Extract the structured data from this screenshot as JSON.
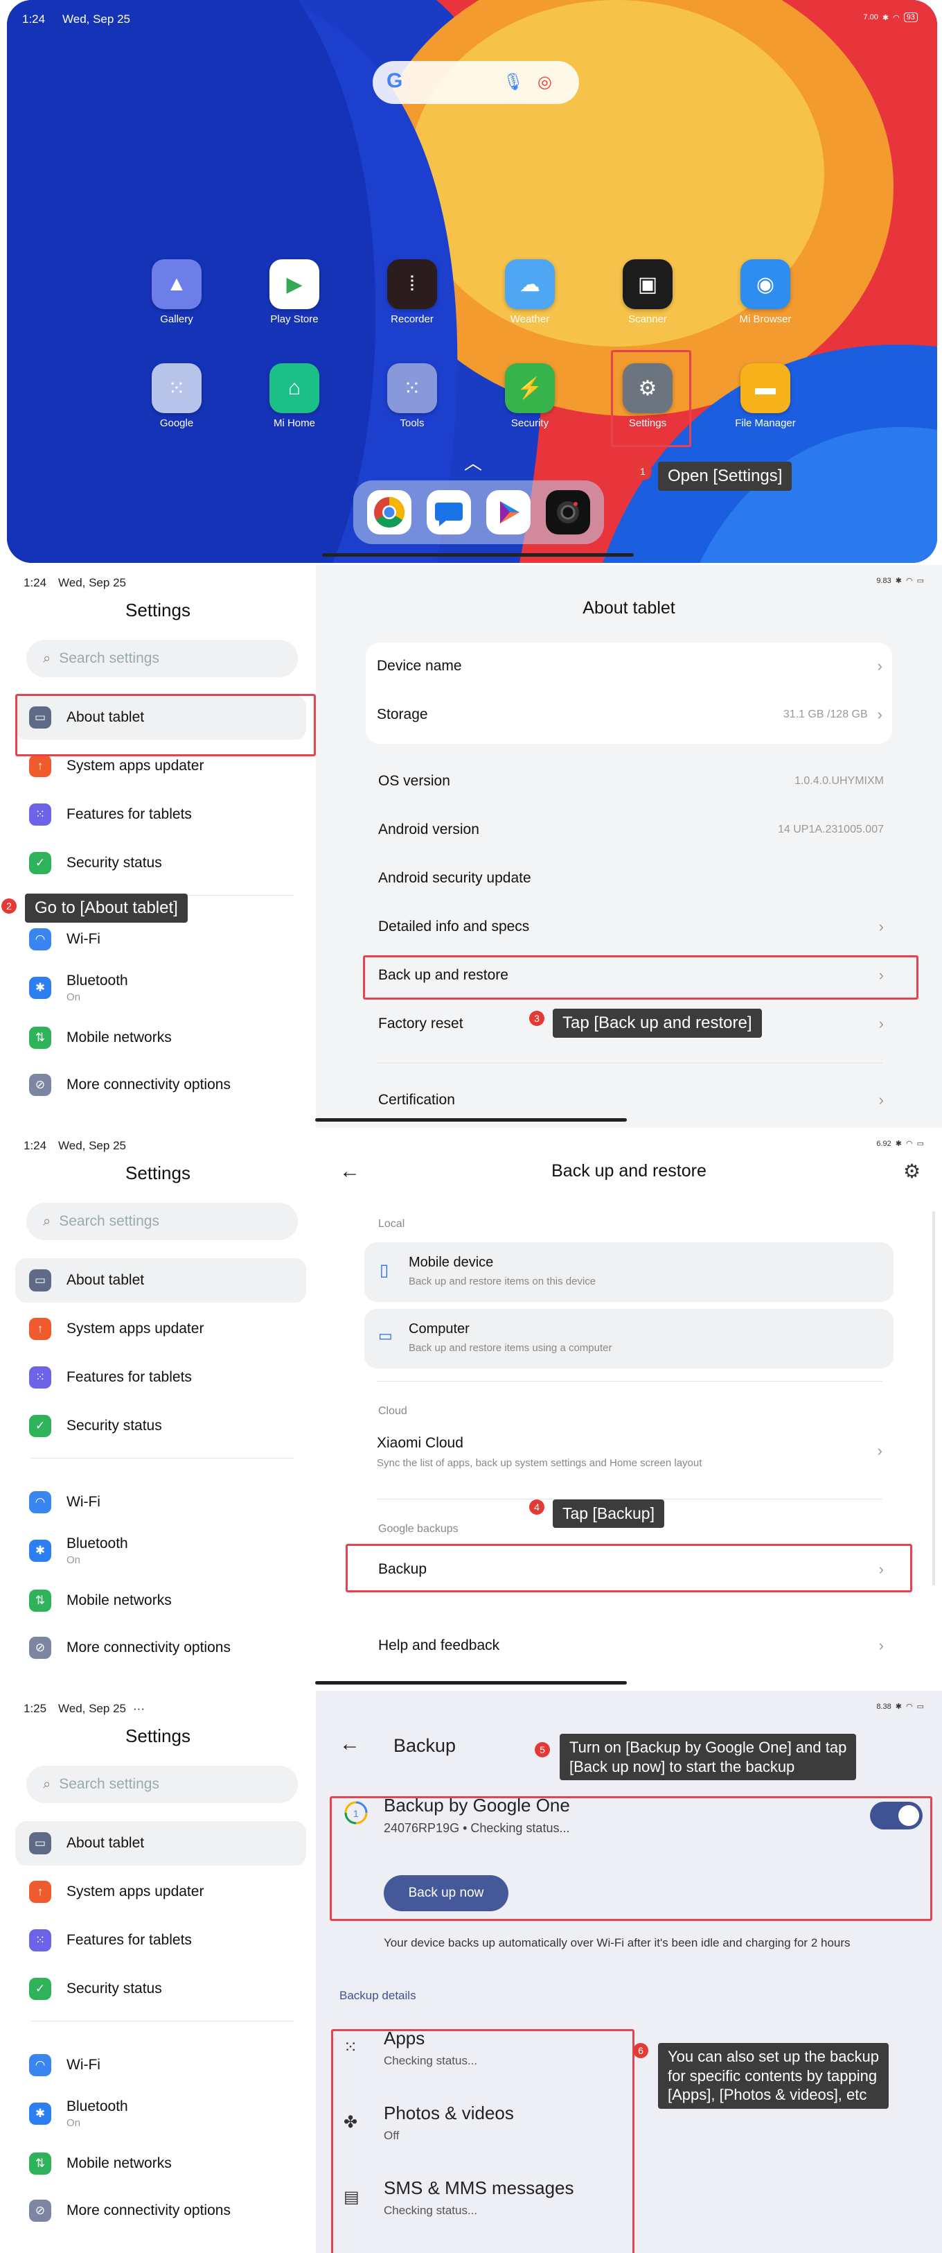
{
  "home": {
    "status_time": "1:24",
    "status_date": "Wed, Sep 25",
    "status_speed": "7.00",
    "status_battery": "93",
    "apps_row1": [
      {
        "label": "Gallery",
        "icon": "gallery-icon",
        "color": "#6d7ee9"
      },
      {
        "label": "Play Store",
        "icon": "play-store-icon",
        "color": "#ffffff"
      },
      {
        "label": "Recorder",
        "icon": "recorder-icon",
        "color": "#2b1d1d"
      },
      {
        "label": "Weather",
        "icon": "weather-icon",
        "color": "#4fa6f2"
      },
      {
        "label": "Scanner",
        "icon": "scanner-icon",
        "color": "#1c1c1c"
      },
      {
        "label": "Mi Browser",
        "icon": "browser-icon",
        "color": "#2f8df0"
      }
    ],
    "apps_row2": [
      {
        "label": "Google",
        "icon": "google-folder-icon",
        "color": "#b7c3e8"
      },
      {
        "label": "Mi Home",
        "icon": "mi-home-icon",
        "color": "#1cbf87"
      },
      {
        "label": "Tools",
        "icon": "tools-folder-icon",
        "color": "#8799da"
      },
      {
        "label": "Security",
        "icon": "security-icon",
        "color": "#36b34a"
      },
      {
        "label": "Settings",
        "icon": "settings-icon",
        "color": "#6c7480"
      },
      {
        "label": "File Manager",
        "icon": "file-manager-icon",
        "color": "#f7b21b"
      }
    ],
    "dock": [
      "chrome-icon",
      "messages-icon",
      "play-games-icon",
      "camera-icon"
    ],
    "tip_number": "1",
    "tip_text": "Open [Settings]"
  },
  "settings_sidebar": {
    "title": "Settings",
    "search_placeholder": "Search settings",
    "items": [
      {
        "label": "About tablet",
        "sub": ""
      },
      {
        "label": "System apps updater",
        "sub": ""
      },
      {
        "label": "Features for tablets",
        "sub": ""
      },
      {
        "label": "Security status",
        "sub": ""
      },
      {
        "label": "Wi-Fi",
        "sub": ""
      },
      {
        "label": "Bluetooth",
        "sub": "On"
      },
      {
        "label": "Mobile networks",
        "sub": ""
      },
      {
        "label": "More connectivity options",
        "sub": ""
      }
    ]
  },
  "panel2": {
    "status_time": "1:24",
    "status_date": "Wed, Sep 25",
    "status_speed": "9.83",
    "title": "About tablet",
    "device_name": "Device name",
    "storage": "Storage",
    "storage_value": "31.1 GB /128 GB",
    "os_version": "OS version",
    "os_version_value": "1.0.4.0.UHYMIXM",
    "android_version": "Android version",
    "android_version_value": "14 UP1A.231005.007",
    "security_update": "Android security update",
    "detailed_info": "Detailed info and specs",
    "backup_restore": "Back up and restore",
    "factory_reset": "Factory reset",
    "certification": "Certification",
    "tip2_number": "2",
    "tip2_text": "Go to [About tablet]",
    "tip3_number": "3",
    "tip3_text": "Tap [Back up and restore]"
  },
  "panel3": {
    "status_time": "1:24",
    "status_date": "Wed, Sep 25",
    "status_speed": "6.92",
    "title": "Back up and restore",
    "local_header": "Local",
    "mobile_title": "Mobile device",
    "mobile_sub": "Back up and restore items on this device",
    "computer_title": "Computer",
    "computer_sub": "Back up and restore items using a computer",
    "cloud_header": "Cloud",
    "xiaomi_title": "Xiaomi Cloud",
    "xiaomi_sub": "Sync the list of apps, back up system settings and Home screen layout",
    "google_header": "Google backups",
    "backup": "Backup",
    "help": "Help and feedback",
    "tip4_number": "4",
    "tip4_text": "Tap [Backup]"
  },
  "panel4": {
    "status_time": "1:25",
    "status_date": "Wed, Sep 25",
    "status_extra": "···",
    "status_speed": "8.38",
    "title": "Backup",
    "google_one_title": "Backup by Google One",
    "google_one_sub": "24076RP19G • Checking status...",
    "back_up_now": "Back up now",
    "info_text": "Your device backs up automatically over Wi-Fi after it's been idle and charging for 2 hours",
    "details_header": "Backup details",
    "apps_title": "Apps",
    "apps_sub": "Checking status...",
    "photos_title": "Photos & videos",
    "photos_sub": "Off",
    "sms_title": "SMS & MMS messages",
    "sms_sub": "Checking status...",
    "tip5_number": "5",
    "tip5_line1": "Turn on [Backup by Google One] and tap",
    "tip5_line2": "[Back up now] to start the backup",
    "tip6_number": "6",
    "tip6_line1": "You can also set up the backup",
    "tip6_line2": "for specific contents by tapping",
    "tip6_line3": "[Apps], [Photos & videos], etc"
  }
}
